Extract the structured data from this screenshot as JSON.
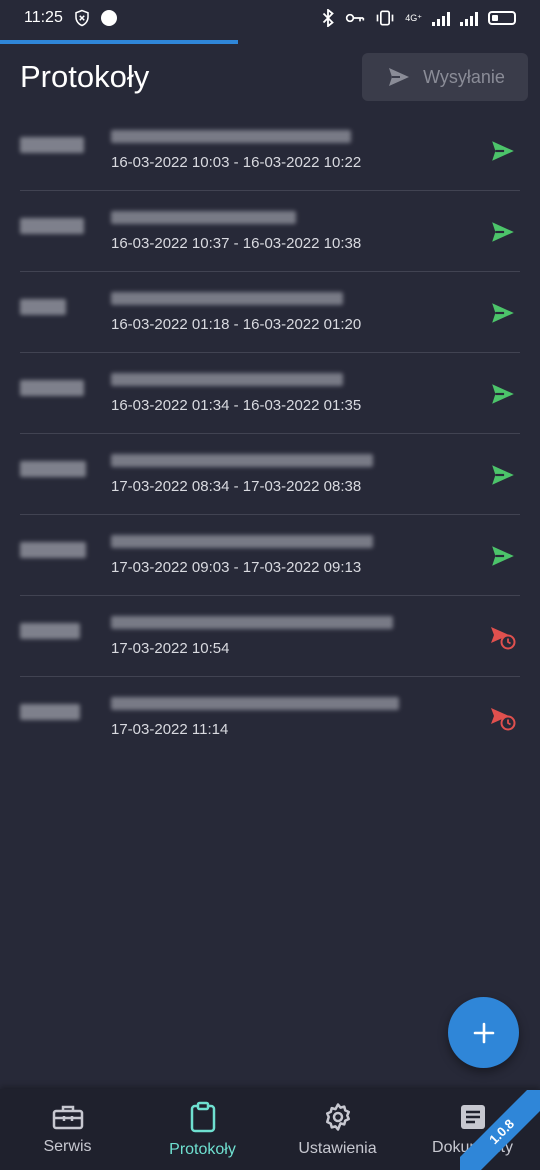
{
  "status_bar": {
    "time": "11:25",
    "network": "4G⁺"
  },
  "header": {
    "title": "Protokoły",
    "send_button": "Wysyłanie",
    "sync_progress": 0.44
  },
  "protocols": [
    {
      "dates": "16-03-2022 10:03 - 16-03-2022 10:22",
      "status": "sent"
    },
    {
      "dates": "16-03-2022 10:37 - 16-03-2022 10:38",
      "status": "sent"
    },
    {
      "dates": "16-03-2022 01:18 - 16-03-2022 01:20",
      "status": "sent"
    },
    {
      "dates": "16-03-2022 01:34 - 16-03-2022 01:35",
      "status": "sent"
    },
    {
      "dates": "17-03-2022 08:34 - 17-03-2022 08:38",
      "status": "sent"
    },
    {
      "dates": "17-03-2022 09:03 - 17-03-2022 09:13",
      "status": "sent"
    },
    {
      "dates": "17-03-2022 10:54",
      "status": "pending"
    },
    {
      "dates": "17-03-2022 11:14",
      "status": "pending"
    }
  ],
  "bottom_nav": [
    {
      "label": "Serwis",
      "icon": "toolbox-icon"
    },
    {
      "label": "Protokoły",
      "icon": "clipboard-icon"
    },
    {
      "label": "Ustawienia",
      "icon": "gear-icon"
    },
    {
      "label": "Dokumenty",
      "icon": "document-icon"
    }
  ],
  "version": "1.0.8",
  "colors": {
    "accent": "#2f86d8",
    "sent": "#4cc46a",
    "pending": "#e0504e",
    "active_tab": "#6fe0d0"
  }
}
